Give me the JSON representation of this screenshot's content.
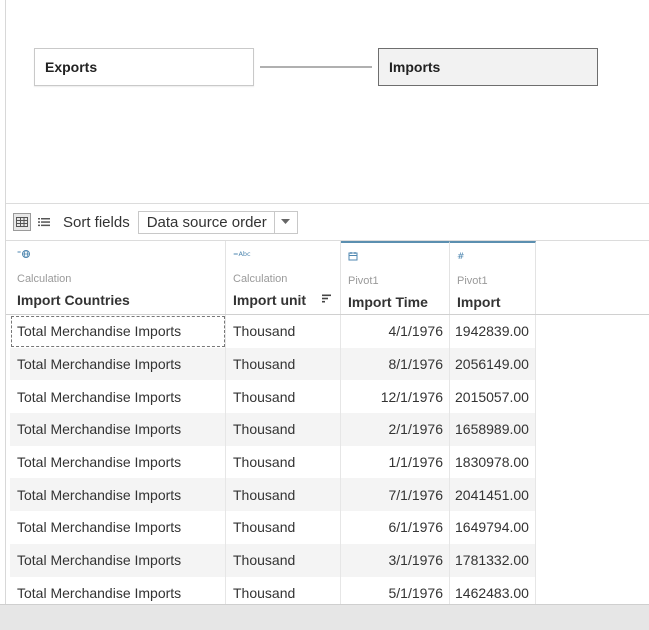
{
  "canvas": {
    "tables": [
      "Exports",
      "Imports"
    ]
  },
  "toolbar": {
    "sort_label": "Sort fields",
    "sort_value": "Data source order"
  },
  "columns": [
    {
      "type_icon": "globe-abc-icon",
      "origin": "Calculation",
      "name": "Import Countries"
    },
    {
      "type_icon": "abc-icon",
      "origin": "Calculation",
      "name": "Import unit"
    },
    {
      "type_icon": "calendar-icon",
      "origin": "Pivot1",
      "name": "Import Time"
    },
    {
      "type_icon": "number-icon",
      "origin": "Pivot1",
      "name": "Import"
    }
  ],
  "rows": [
    [
      "Total Merchandise Imports",
      "Thousand",
      "4/1/1976",
      "1942839.00"
    ],
    [
      "Total Merchandise Imports",
      "Thousand",
      "8/1/1976",
      "2056149.00"
    ],
    [
      "Total Merchandise Imports",
      "Thousand",
      "12/1/1976",
      "2015057.00"
    ],
    [
      "Total Merchandise Imports",
      "Thousand",
      "2/1/1976",
      "1658989.00"
    ],
    [
      "Total Merchandise Imports",
      "Thousand",
      "1/1/1976",
      "1830978.00"
    ],
    [
      "Total Merchandise Imports",
      "Thousand",
      "7/1/1976",
      "2041451.00"
    ],
    [
      "Total Merchandise Imports",
      "Thousand",
      "6/1/1976",
      "1649794.00"
    ],
    [
      "Total Merchandise Imports",
      "Thousand",
      "3/1/1976",
      "1781332.00"
    ],
    [
      "Total Merchandise Imports",
      "Thousand",
      "5/1/1976",
      "1462483.00"
    ]
  ],
  "colors": {
    "accent": "#5b8fb0",
    "selected_table_bg": "#f2f2f2"
  }
}
